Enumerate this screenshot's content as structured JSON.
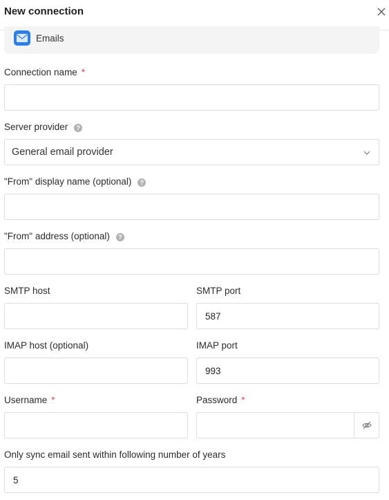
{
  "dialog": {
    "title": "New connection",
    "close_icon": "close-icon"
  },
  "connection_type": {
    "icon": "email-app-icon",
    "label": "Emails",
    "accent_color": "#2a7fe8"
  },
  "fields": {
    "connection_name": {
      "label": "Connection name",
      "required_mark": "*",
      "value": ""
    },
    "server_provider": {
      "label": "Server provider",
      "help_icon": "help-icon",
      "selected": "General email provider"
    },
    "from_display_name": {
      "label": "\"From\" display name (optional)",
      "help_icon": "help-icon",
      "value": ""
    },
    "from_address": {
      "label": "\"From\" address (optional)",
      "help_icon": "help-icon",
      "value": ""
    },
    "smtp_host": {
      "label": "SMTP host",
      "value": ""
    },
    "smtp_port": {
      "label": "SMTP port",
      "value": "587"
    },
    "imap_host": {
      "label": "IMAP host (optional)",
      "value": ""
    },
    "imap_port": {
      "label": "IMAP port",
      "value": "993"
    },
    "username": {
      "label": "Username",
      "required_mark": "*",
      "value": ""
    },
    "password": {
      "label": "Password",
      "required_mark": "*",
      "value": "",
      "toggle_icon": "eye-off-icon"
    },
    "sync_years": {
      "label": "Only sync email sent within following number of years",
      "value": "5"
    }
  },
  "colors": {
    "required": "#e8465b",
    "border": "#dcdcdc",
    "help_icon": "#b2b2b2"
  }
}
